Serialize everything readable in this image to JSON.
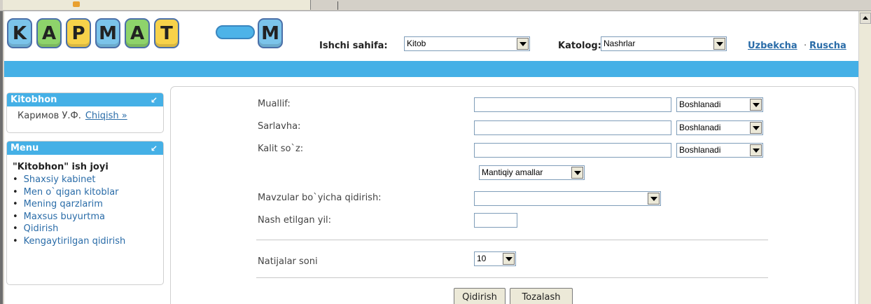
{
  "header": {
    "logo_letters": [
      "K",
      "A",
      "P",
      "M",
      "A",
      "T",
      "M"
    ],
    "logo_colors": [
      "#7bc4ea",
      "#8ed36b",
      "#f7d24a",
      "#7bc4ea",
      "#8ed36b",
      "#f7d24a",
      "#7bc4ea"
    ],
    "workspace_label": "Ishchi sahifa:",
    "workspace_value": "Kitob",
    "catalog_label": "Katolog:",
    "catalog_value": "Nashrlar",
    "lang_uz": "Uzbekcha",
    "lang_sep": "·",
    "lang_ru": "Ruscha"
  },
  "sidebar": {
    "user_title": "Kitobhon",
    "user_name": "Каримов У.Ф.",
    "logout": "Chiqish »",
    "menu_title": "Menu",
    "menu_heading": "\"Kitobhon\" ish joyi",
    "items": [
      "Shaxsiy kabinet",
      "Men o`qigan kitoblar",
      "Mening qarzlarim",
      "Maxsus buyurtma",
      "Qidirish",
      "Kengaytirilgan qidirish"
    ]
  },
  "form": {
    "author_label": "Muallif:",
    "title_label": "Sarlavha:",
    "keyword_label": "Kalit so`z:",
    "match_mode": "Boshlanadi",
    "logic_ops": "Mantiqiy amallar",
    "subject_label": "Mavzular bo`yicha qidirish:",
    "subject_value": "",
    "year_label": "Nash etilgan yil:",
    "results_label": "Natijalar soni",
    "results_value": "10",
    "search_button": "Qidirish",
    "clear_button": "Tozalash"
  },
  "colors": {
    "accent": "#45b0e6",
    "link": "#2a6ca8"
  }
}
